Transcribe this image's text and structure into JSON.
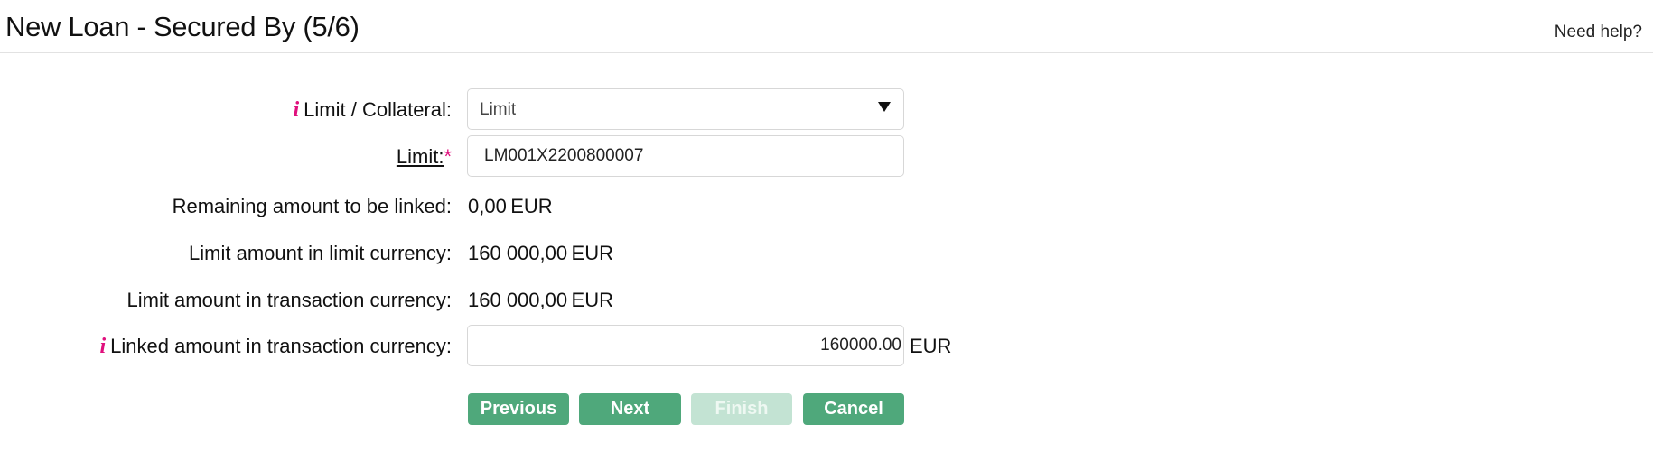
{
  "header": {
    "title": "New Loan - Secured By (5/6)",
    "help_link": "Need help?"
  },
  "form": {
    "limit_collateral": {
      "label": "Limit / Collateral:",
      "value": "Limit",
      "info_icon": "i"
    },
    "limit": {
      "label": "Limit:",
      "required_marker": "*",
      "value": "LM001X2200800007"
    },
    "remaining_amount": {
      "label": "Remaining amount to be linked:",
      "value": "0,00",
      "currency": "EUR"
    },
    "limit_amount_limit_currency": {
      "label": "Limit amount in limit currency:",
      "value": "160 000,00",
      "currency": "EUR"
    },
    "limit_amount_transaction_currency": {
      "label": "Limit amount in transaction currency:",
      "value": "160 000,00",
      "currency": "EUR"
    },
    "linked_amount": {
      "label": "Linked amount in transaction currency:",
      "value": "160000.00",
      "currency": "EUR",
      "info_icon": "i"
    }
  },
  "buttons": {
    "previous": "Previous",
    "next": "Next",
    "finish": "Finish",
    "cancel": "Cancel"
  },
  "colors": {
    "accent": "#e0107d",
    "button": "#4fa87b",
    "button_disabled": "#c3e3d3"
  },
  "icons": {
    "info": "info-icon",
    "dropdown": "caret-down-icon"
  }
}
